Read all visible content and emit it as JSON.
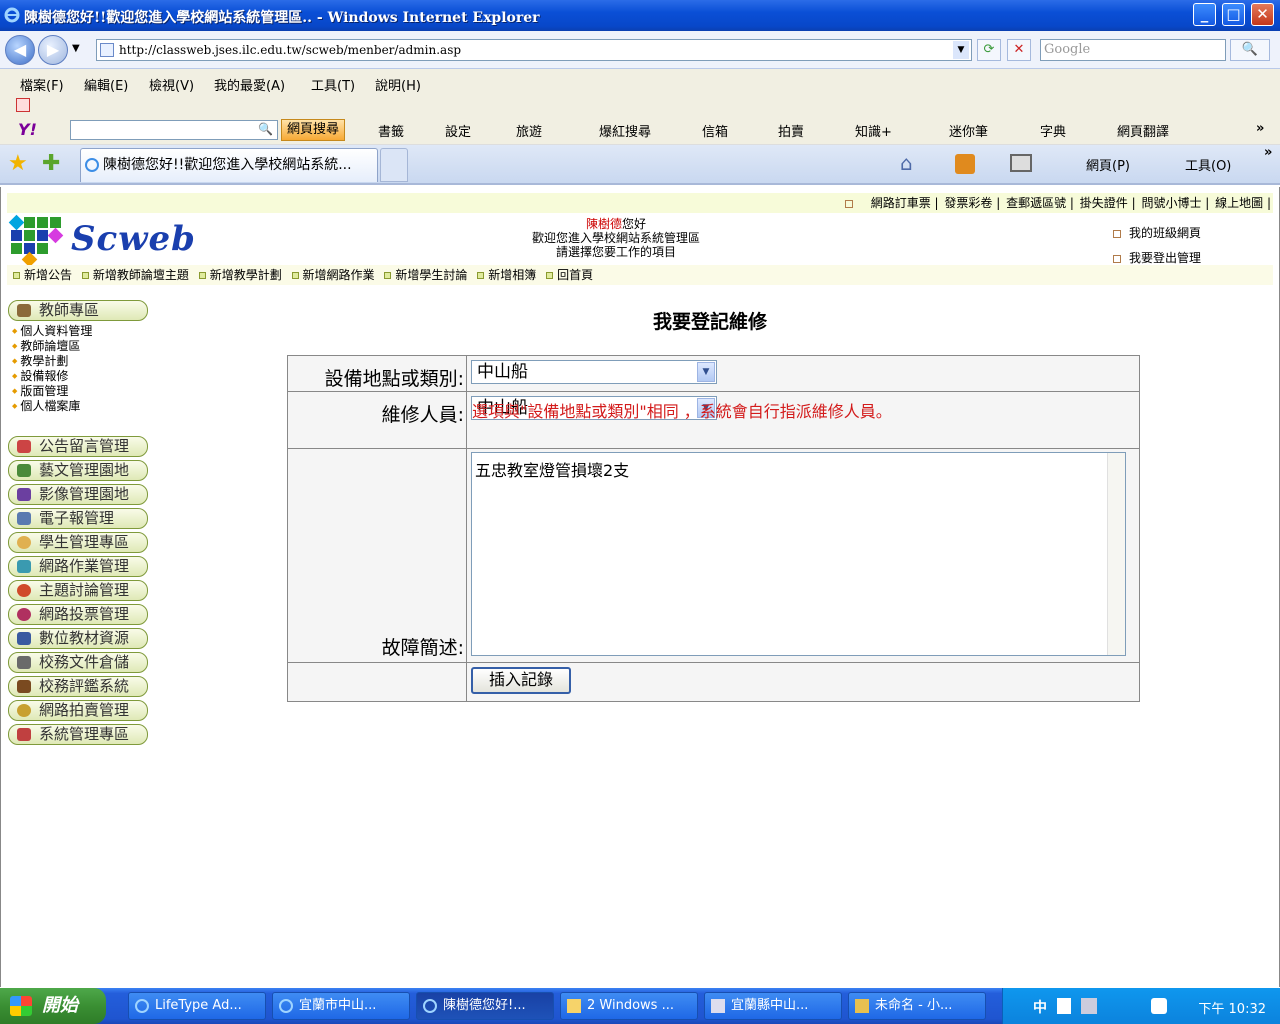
{
  "window": {
    "title": "陳樹德您好!!歡迎您進入學校網站系統管理區.. - Windows Internet Explorer",
    "min": "_",
    "max": "□",
    "close": "✕"
  },
  "address": {
    "url": "http://classweb.jses.ilc.edu.tw/scweb/menber/admin.asp",
    "search_placeholder": "Google",
    "back": "◀",
    "forward": "▶",
    "refresh": "⟳",
    "stop": "✕",
    "go": "🔍"
  },
  "menu": [
    "檔案(F)",
    "編輯(E)",
    "檢視(V)",
    "我的最愛(A)",
    "工具(T)",
    "說明(H)"
  ],
  "yahoo": {
    "logo": "Y!",
    "search_btn": "網頁搜尋",
    "items": [
      "書籤",
      "設定",
      "旅遊",
      "爆紅搜尋",
      "信箱",
      "拍賣",
      "知識+",
      "迷你筆",
      "字典",
      "網頁翻譯"
    ],
    "more": "»"
  },
  "tabs": {
    "active": "陳樹德您好!!歡迎您進入學校網站系統...",
    "right": [
      "網頁(P)",
      "工具(O)"
    ],
    "more": "»"
  },
  "site": {
    "toplinks": [
      "網路訂車票",
      "發票彩卷",
      "查郵遞區號",
      "掛失證件",
      "問號小博士",
      "線上地圖"
    ],
    "logo_text": "Scweb",
    "welcome_name": "陳樹德",
    "welcome_suffix": "您好",
    "welcome_line2": "歡迎您進入學校網站系統管理區",
    "welcome_line3": "請選擇您要工作的項目",
    "right_links": [
      "我的班級網頁",
      "我要登出管理"
    ],
    "cmds": [
      "新增公告",
      "新增教師論壇主題",
      "新增教學計劃",
      "新增網路作業",
      "新增學生討論",
      "新增相簿",
      "回首頁"
    ],
    "sidebar_head": "教師專區",
    "sidebar_sub": [
      "個人資料管理",
      "教師論壇區",
      "教學計劃",
      "設備報修",
      "版面管理",
      "個人檔案庫"
    ],
    "sidebar_pills": [
      "公告留言管理",
      "藝文管理園地",
      "影像管理園地",
      "電子報管理",
      "學生管理專區",
      "網路作業管理",
      "主題討論管理",
      "網路投票管理",
      "數位教材資源",
      "校務文件倉儲",
      "校務評鑑系統",
      "網路拍賣管理",
      "系統管理專區"
    ]
  },
  "form": {
    "title": "我要登記維修",
    "location_label": "設備地點或類別:",
    "location_value": "中山船",
    "staff_label": "維修人員:",
    "staff_value": "中山船",
    "staff_note": "選項與\"設備地點或類別\"相同 ，系統會自行指派維修人員。",
    "desc_label": "故障簡述:",
    "desc_value": "五忠教室燈管損壞2支",
    "submit": "插入記錄"
  },
  "taskbar": {
    "start": "開始",
    "items": [
      "LifeType Ad...",
      "宜蘭市中山...",
      "陳樹德您好!...",
      "2 Windows ...",
      "宜蘭縣中山...",
      "未命名 - 小..."
    ],
    "ime": "中",
    "clock": "下午 10:32"
  }
}
